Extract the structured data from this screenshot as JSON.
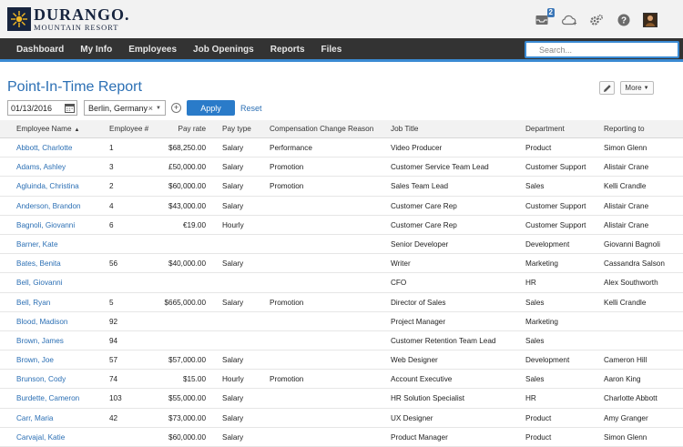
{
  "header": {
    "logo_main": "DURANGO.",
    "logo_sub": "MOUNTAIN RESORT",
    "inbox_count": "2"
  },
  "nav": {
    "items": [
      "Dashboard",
      "My Info",
      "Employees",
      "Job Openings",
      "Reports",
      "Files"
    ],
    "search_placeholder": "Search..."
  },
  "report": {
    "title": "Point-In-Time Report",
    "more_label": "More",
    "date_value": "01/13/2016",
    "location_value": "Berlin, Germany",
    "clear_symbol": "×",
    "add_symbol": "+",
    "apply_label": "Apply",
    "reset_label": "Reset"
  },
  "table": {
    "columns": [
      "Employee Name",
      "Employee #",
      "Pay rate",
      "Pay type",
      "Compensation Change Reason",
      "Job Title",
      "Department",
      "Reporting to"
    ],
    "rows": [
      [
        "Abbott, Charlotte",
        "1",
        "$68,250.00",
        "Salary",
        "Performance",
        "Video Producer",
        "Product",
        "Simon Glenn"
      ],
      [
        "Adams, Ashley",
        "3",
        "£50,000.00",
        "Salary",
        "Promotion",
        "Customer Service Team Lead",
        "Customer Support",
        "Alistair Crane"
      ],
      [
        "Agluinda, Christina",
        "2",
        "$60,000.00",
        "Salary",
        "Promotion",
        "Sales Team Lead",
        "Sales",
        "Kelli Crandle"
      ],
      [
        "Anderson, Brandon",
        "4",
        "$43,000.00",
        "Salary",
        "",
        "Customer Care Rep",
        "Customer Support",
        "Alistair Crane"
      ],
      [
        "Bagnoli, Giovanni",
        "6",
        "€19.00",
        "Hourly",
        "",
        "Customer Care Rep",
        "Customer Support",
        "Alistair Crane"
      ],
      [
        "Barner, Kate",
        "",
        "",
        "",
        "",
        "Senior Developer",
        "Development",
        "Giovanni Bagnoli"
      ],
      [
        "Bates, Benita",
        "56",
        "$40,000.00",
        "Salary",
        "",
        "Writer",
        "Marketing",
        "Cassandra Salson"
      ],
      [
        "Bell, Giovanni",
        "",
        "",
        "",
        "",
        "CFO",
        "HR",
        "Alex Southworth"
      ],
      [
        "Bell, Ryan",
        "5",
        "$665,000.00",
        "Salary",
        "Promotion",
        "Director of Sales",
        "Sales",
        "Kelli Crandle"
      ],
      [
        "Blood, Madison",
        "92",
        "",
        "",
        "",
        "Project Manager",
        "Marketing",
        ""
      ],
      [
        "Brown, James",
        "94",
        "",
        "",
        "",
        "Customer Retention Team Lead",
        "Sales",
        ""
      ],
      [
        "Brown, Joe",
        "57",
        "$57,000.00",
        "Salary",
        "",
        "Web Designer",
        "Development",
        "Cameron Hill"
      ],
      [
        "Brunson, Cody",
        "74",
        "$15.00",
        "Hourly",
        "Promotion",
        "Account Executive",
        "Sales",
        "Aaron King"
      ],
      [
        "Burdette, Cameron",
        "103",
        "$55,000.00",
        "Salary",
        "",
        "HR Solution Specialist",
        "HR",
        "Charlotte Abbott"
      ],
      [
        "Carr, Maria",
        "42",
        "$73,000.00",
        "Salary",
        "",
        "UX Designer",
        "Product",
        "Amy Granger"
      ],
      [
        "Carvajal, Katie",
        "",
        "$60,000.00",
        "Salary",
        "",
        "Product Manager",
        "Product",
        "Simon Glenn"
      ]
    ]
  }
}
